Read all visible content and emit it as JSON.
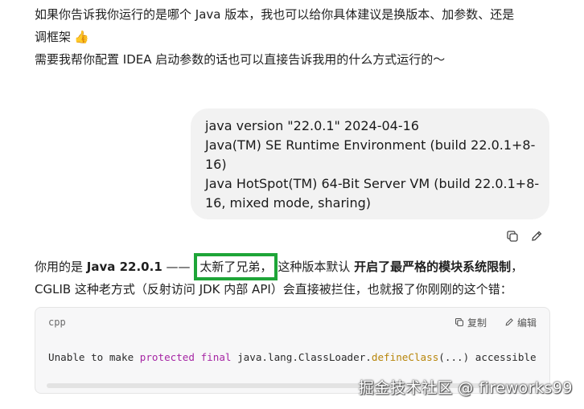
{
  "assistant": {
    "line1": "如果你告诉我你运行的是哪个 Java 版本，我也可以给你具体建议是换版本、加参数、还是",
    "line2": "调框架",
    "line3": "需要我帮你配置 IDEA 启动参数的话也可以直接告诉我用的什么方式运行的～",
    "thumb_icon": "thumbs-up-emoji"
  },
  "user_message": {
    "lines": [
      "java version \"22.0.1\" 2024-04-16",
      "Java(TM) SE Runtime Environment (build 22.0.1+8-",
      "16)",
      "Java HotSpot(TM) 64-Bit Server VM (build 22.0.1+8-",
      "16, mixed mode, sharing)"
    ],
    "actions": [
      "copy-icon",
      "edit-icon"
    ]
  },
  "reply": {
    "p1_a": "你用的是 ",
    "p1_b": "Java 22.0.1",
    "p1_c": " —— ",
    "p1_highlight": "太新了兄弟，",
    "p1_d": "这种版本默认 ",
    "p1_e": "开启了最严格的模块系统限制",
    "p1_f": "，",
    "p2": "CGLIB 这种老方式（反射访问 JDK 内部 API）会直接被拦住，也就报了你刚刚的这个错："
  },
  "code": {
    "language": "cpp",
    "copy_label": "复制",
    "edit_label": "编辑",
    "tokens": {
      "t1": "Unable to make ",
      "t2": "protected",
      "t3": " ",
      "t4": "final",
      "t5": " java.lang.ClassLoader.",
      "t6": "defineClass",
      "t7": "(...) accessible"
    }
  },
  "watermark": "掘金技术社区 @ fireworks99",
  "colors": {
    "highlight_border": "#1ea538",
    "keyword": "#a626a4",
    "function": "#b8860b",
    "bubble_bg": "#f2f2f2"
  }
}
